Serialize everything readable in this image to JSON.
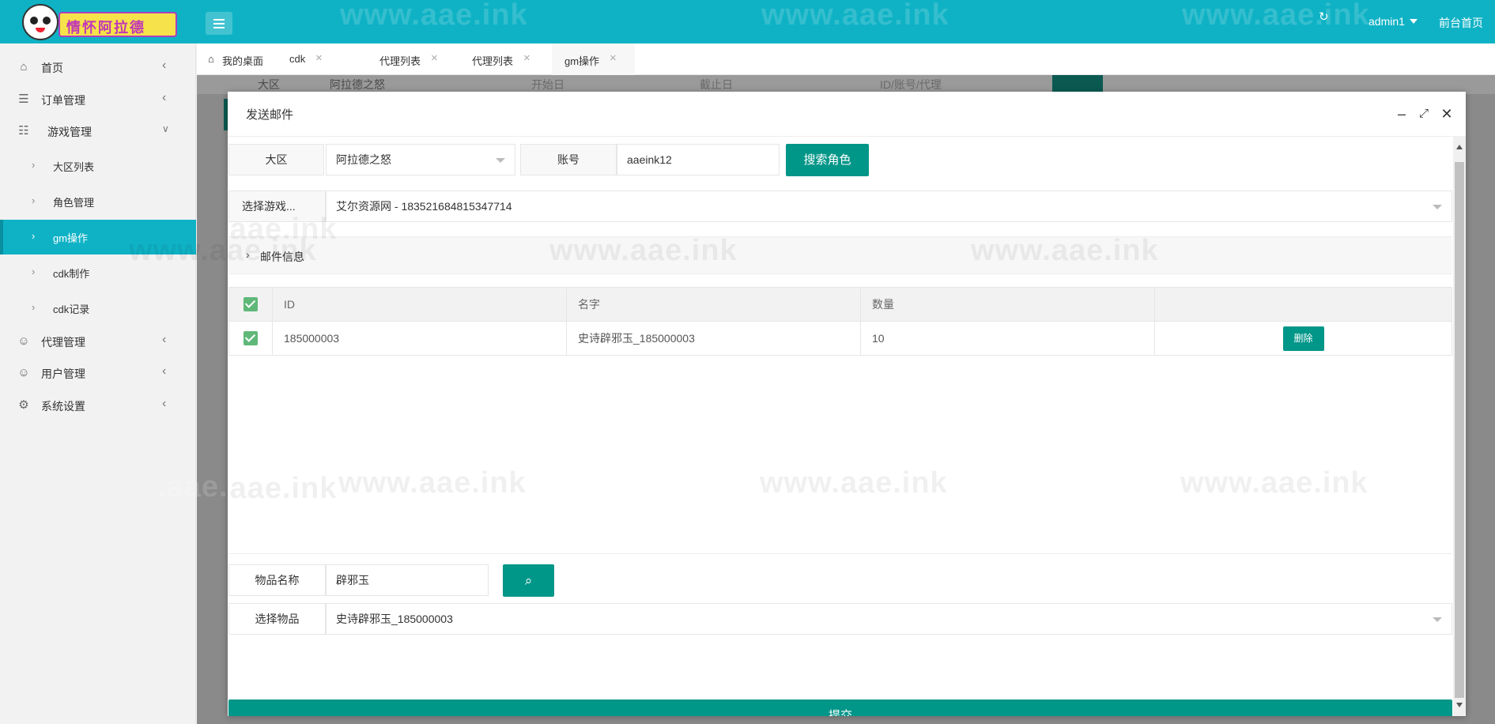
{
  "header": {
    "logo_text": "情怀阿拉德",
    "user": "admin1",
    "front_home": "前台首页"
  },
  "sidebar": {
    "items": [
      {
        "label": "首页",
        "icon": "home-icon"
      },
      {
        "label": "订单管理",
        "icon": "file-icon"
      },
      {
        "label": "游戏管理",
        "icon": "sitemap-icon"
      },
      {
        "label": "代理管理",
        "icon": "user-icon"
      },
      {
        "label": "用户管理",
        "icon": "user-icon"
      },
      {
        "label": "系统设置",
        "icon": "gear-icon"
      }
    ],
    "game_subitems": [
      {
        "label": "大区列表"
      },
      {
        "label": "角色管理"
      },
      {
        "label": "gm操作"
      },
      {
        "label": "cdk制作"
      },
      {
        "label": "cdk记录"
      }
    ]
  },
  "tabs": [
    {
      "label": "我的桌面"
    },
    {
      "label": "cdk"
    },
    {
      "label": "代理列表"
    },
    {
      "label": "代理列表"
    },
    {
      "label": "gm操作"
    }
  ],
  "background": {
    "region_label": "大区",
    "region_value": "阿拉德之怒",
    "start_placeholder": "开始日",
    "end_placeholder": "截止日",
    "id_placeholder": "ID/账号/代理"
  },
  "modal": {
    "title": "发送邮件",
    "region_label": "大区",
    "region_value": "阿拉德之怒",
    "account_label": "账号",
    "account_value": "aaeink12",
    "search_role_button": "搜索角色",
    "select_role_label": "选择游戏...",
    "select_role_value": "艾尔资源网 - 183521684815347714",
    "mail_info_label": "邮件信息",
    "table": {
      "headers": [
        "ID",
        "名字",
        "数量"
      ],
      "rows": [
        {
          "id": "185000003",
          "name": "史诗辟邪玉_185000003",
          "qty": "10",
          "action": "删除"
        }
      ]
    },
    "item_name_label": "物品名称",
    "item_name_value": "辟邪玉",
    "select_item_label": "选择物品",
    "select_item_value": "史诗辟邪玉_185000003",
    "submit_button": "提交"
  },
  "watermark": "www.aae.ink",
  "watermark_partial": ".aae.ink",
  "colors": {
    "header": "#0fb2c5",
    "primary": "#009688",
    "checkbox": "#5fb878"
  }
}
